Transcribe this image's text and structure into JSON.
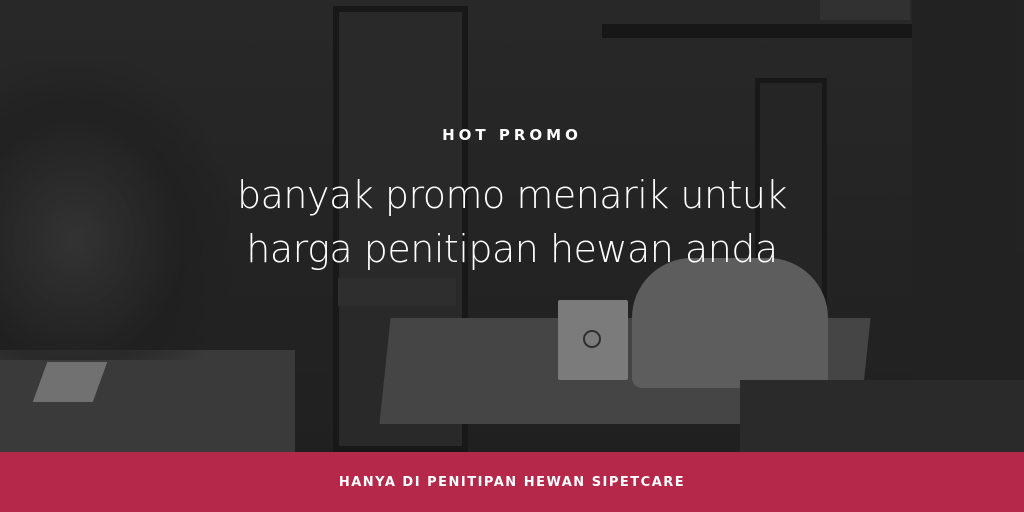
{
  "banner": {
    "kicker": "HOT PROMO",
    "title_line1": "banyak promo menarik untuk",
    "title_line2": "harga penitipan hewan anda",
    "footer": "HANYA DI PENITIPAN HEWAN SIPETCARE"
  },
  "colors": {
    "accent": "#b5284a",
    "text": "#ffffff"
  }
}
